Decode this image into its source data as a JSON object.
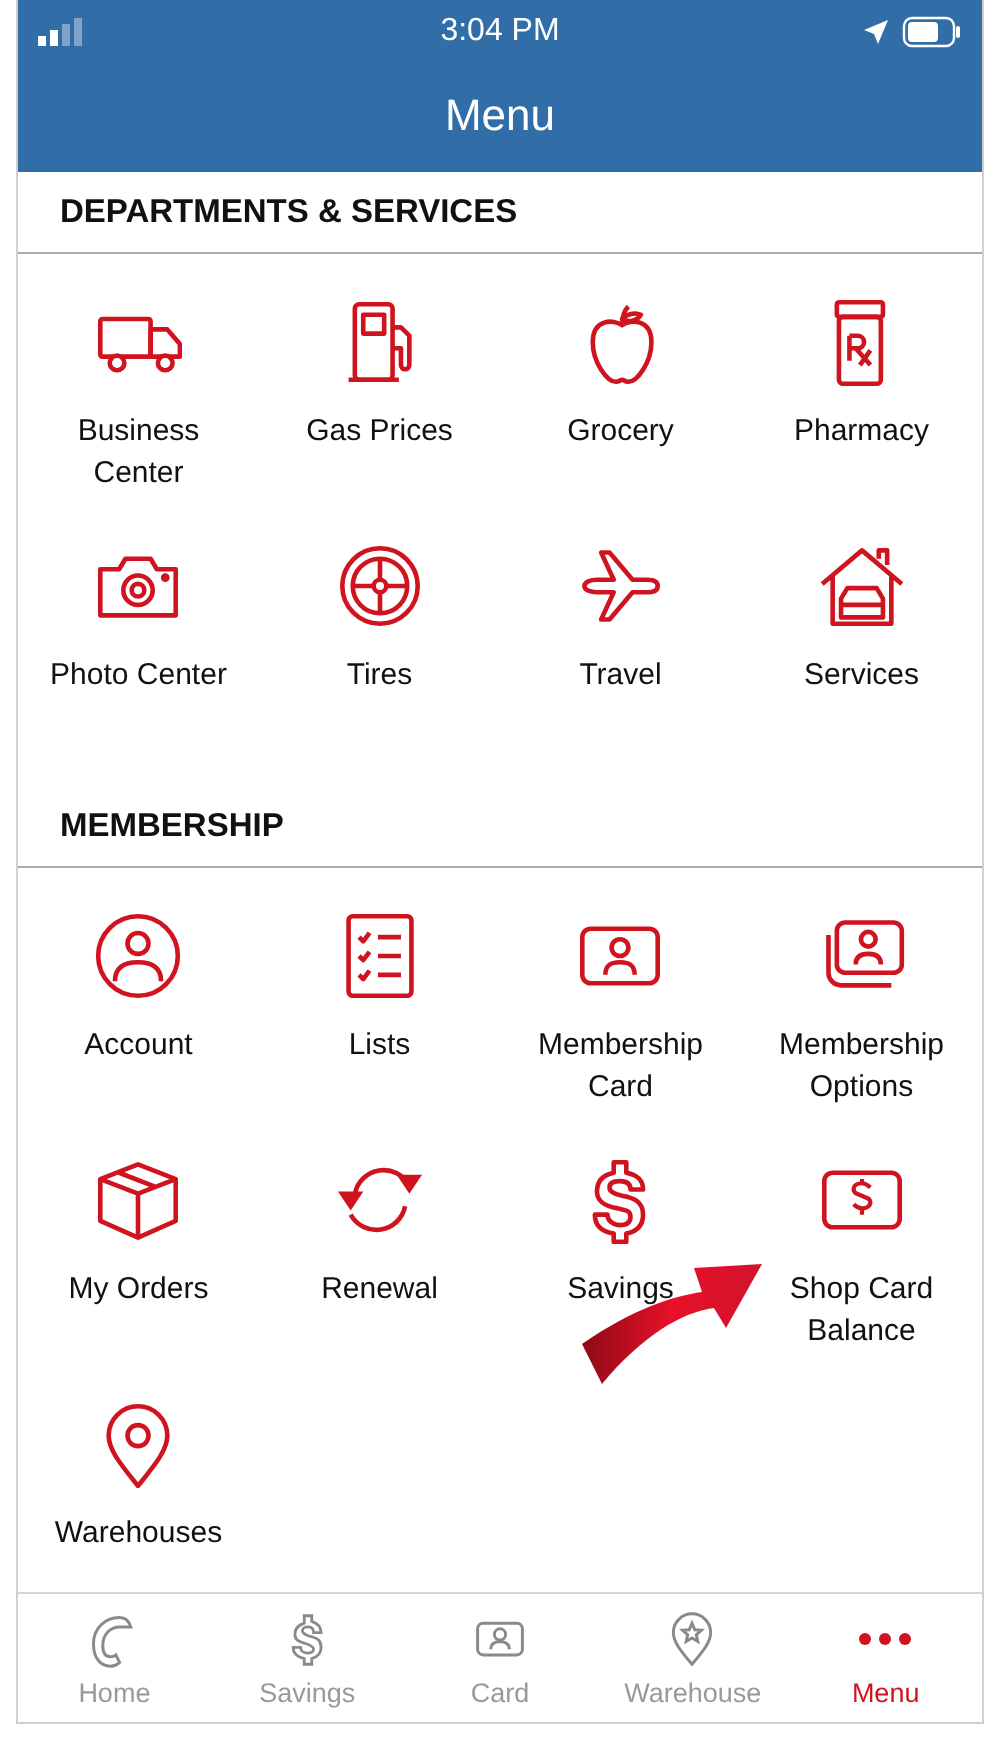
{
  "status_bar": {
    "time": "3:04 PM"
  },
  "header": {
    "title": "Menu"
  },
  "sections": [
    {
      "title": "DEPARTMENTS & SERVICES",
      "items": [
        {
          "label": "Business Center"
        },
        {
          "label": "Gas Prices"
        },
        {
          "label": "Grocery"
        },
        {
          "label": "Pharmacy"
        },
        {
          "label": "Photo Center"
        },
        {
          "label": "Tires"
        },
        {
          "label": "Travel"
        },
        {
          "label": "Services"
        }
      ]
    },
    {
      "title": "MEMBERSHIP",
      "items": [
        {
          "label": "Account"
        },
        {
          "label": "Lists"
        },
        {
          "label": "Membership Card"
        },
        {
          "label": "Membership Options"
        },
        {
          "label": "My Orders"
        },
        {
          "label": "Renewal"
        },
        {
          "label": "Savings"
        },
        {
          "label": "Shop Card Balance"
        },
        {
          "label": "Warehouses"
        }
      ]
    }
  ],
  "tab_bar": [
    {
      "label": "Home",
      "selected": false
    },
    {
      "label": "Savings",
      "selected": false
    },
    {
      "label": "Card",
      "selected": false
    },
    {
      "label": "Warehouse",
      "selected": false
    },
    {
      "label": "Menu",
      "selected": true
    }
  ]
}
